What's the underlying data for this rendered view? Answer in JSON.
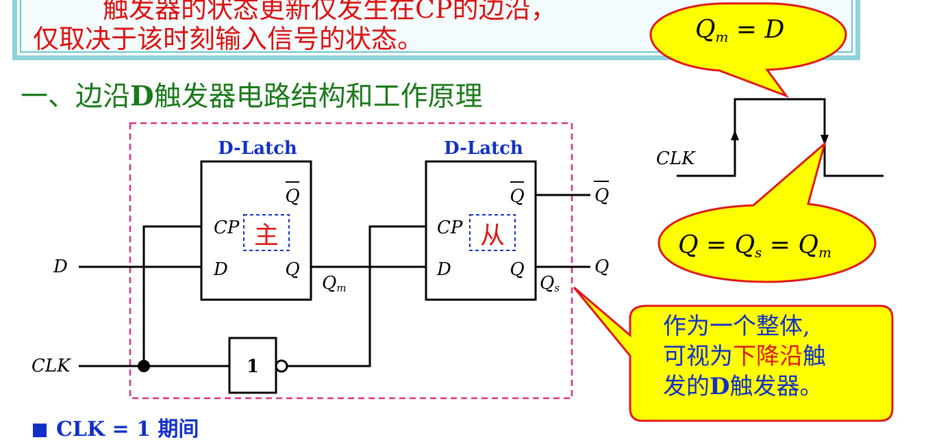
{
  "top_text": {
    "line1": "触发器的状态更新仅发生在CP的边沿，",
    "line2": "仅取决于该时刻输入信号的状态。"
  },
  "heading": {
    "prefix": "一、边沿",
    "bold": "D",
    "suffix": "触发器电路结构和工作原理"
  },
  "latch_master": {
    "title": "D-Latch",
    "qbar": "Q",
    "cp": "CP",
    "d": "D",
    "q": "Q",
    "tag": "主"
  },
  "latch_slave": {
    "title": "D-Latch",
    "qbar": "Q",
    "cp": "CP",
    "d": "D",
    "q": "Q",
    "tag": "从"
  },
  "signals": {
    "d_in": "D",
    "clk_in": "CLK",
    "qm": "Q",
    "qm_sub": "m",
    "qs": "Q",
    "qs_sub": "s",
    "q_out": "Q",
    "qbar_out": "Q"
  },
  "not_gate": {
    "label": "1"
  },
  "waveform": {
    "clk_label": "CLK"
  },
  "callout_top": {
    "lhs": "Q",
    "sub": "m",
    "eq": " = ",
    "rhs": "D"
  },
  "callout_bottom": {
    "q": "Q",
    "eq1": " = ",
    "qs": "Q",
    "qs_sub": "s",
    "eq2": " = ",
    "qm": "Q",
    "qm_sub": "m"
  },
  "note": {
    "line1": "作为一个整体,",
    "line2_a": "可视为",
    "line2_b": "下降沿",
    "line2_c": "触",
    "line3_a": "发的",
    "line3_b": "D",
    "line3_c": "触发器。"
  },
  "bottom": {
    "text": "CLK = 1 期间"
  },
  "colors": {
    "teal_border": "#8fd3d8",
    "red_text": "#d11",
    "green_heading": "#1a7a1a",
    "blue_text": "#1230c8",
    "callout_fill": "#ffff00",
    "callout_border": "#e01818",
    "dashed_box": "#e0307a"
  }
}
